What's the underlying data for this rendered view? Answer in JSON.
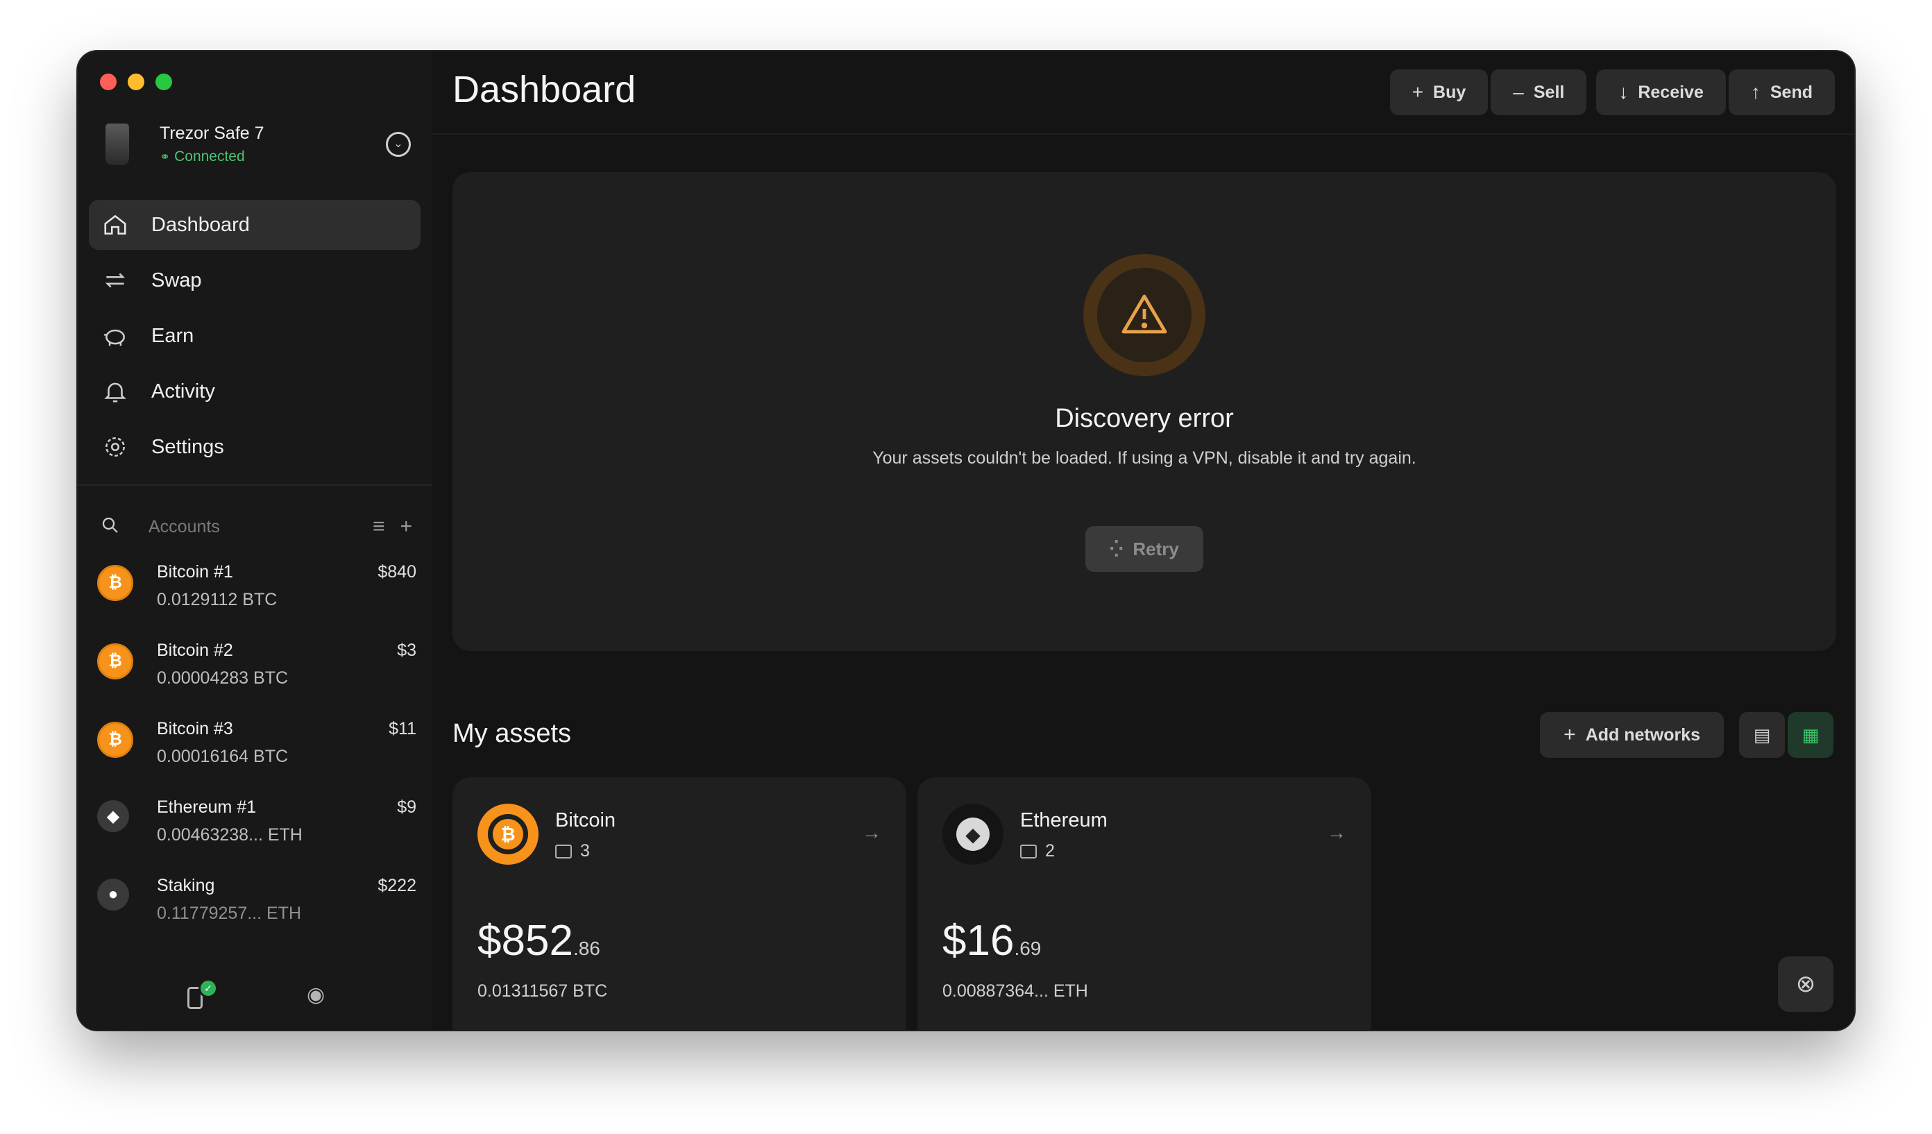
{
  "window": {
    "traffic_colors": [
      "#ff5f57",
      "#febc2e",
      "#28c840"
    ]
  },
  "device": {
    "name": "Trezor Safe 7",
    "status": "Connected"
  },
  "nav": {
    "items": [
      {
        "label": "Dashboard",
        "icon": "home-icon",
        "active": true
      },
      {
        "label": "Swap",
        "icon": "swap-icon",
        "active": false
      },
      {
        "label": "Earn",
        "icon": "piggy-bank-icon",
        "active": false
      },
      {
        "label": "Activity",
        "icon": "bell-icon",
        "active": false
      },
      {
        "label": "Settings",
        "icon": "gear-icon",
        "active": false
      }
    ]
  },
  "accounts": {
    "search_placeholder": "Accounts",
    "list": [
      {
        "name": "Bitcoin #1",
        "value": "$840",
        "amount": "0.0129112 BTC",
        "coin": "btc"
      },
      {
        "name": "Bitcoin #2",
        "value": "$3",
        "amount": "0.00004283 BTC",
        "coin": "btc"
      },
      {
        "name": "Bitcoin #3",
        "value": "$11",
        "amount": "0.00016164 BTC",
        "coin": "btc"
      },
      {
        "name": "Ethereum #1",
        "value": "$9",
        "amount": "0.00463238... ETH",
        "coin": "eth"
      },
      {
        "name": "Staking",
        "value": "$222",
        "amount": "0.11779257... ETH",
        "coin": "stake"
      }
    ]
  },
  "header": {
    "title": "Dashboard",
    "buy": "Buy",
    "sell": "Sell",
    "receive": "Receive",
    "send": "Send"
  },
  "error": {
    "title": "Discovery error",
    "description": "Your assets couldn't be loaded. If using a VPN, disable it and try again.",
    "retry": "Retry"
  },
  "assets": {
    "title": "My assets",
    "add_networks": "Add networks",
    "cards": [
      {
        "name": "Bitcoin",
        "accounts": "3",
        "value_main": "$852",
        "value_cents": ".86",
        "crypto": "0.01311567 BTC"
      },
      {
        "name": "Ethereum",
        "accounts": "2",
        "value_main": "$16",
        "value_cents": ".69",
        "crypto": "0.00887364... ETH"
      }
    ]
  },
  "colors": {
    "accent_green": "#40c36b",
    "bitcoin_orange": "#f7931a",
    "warning": "#e8a24a"
  }
}
